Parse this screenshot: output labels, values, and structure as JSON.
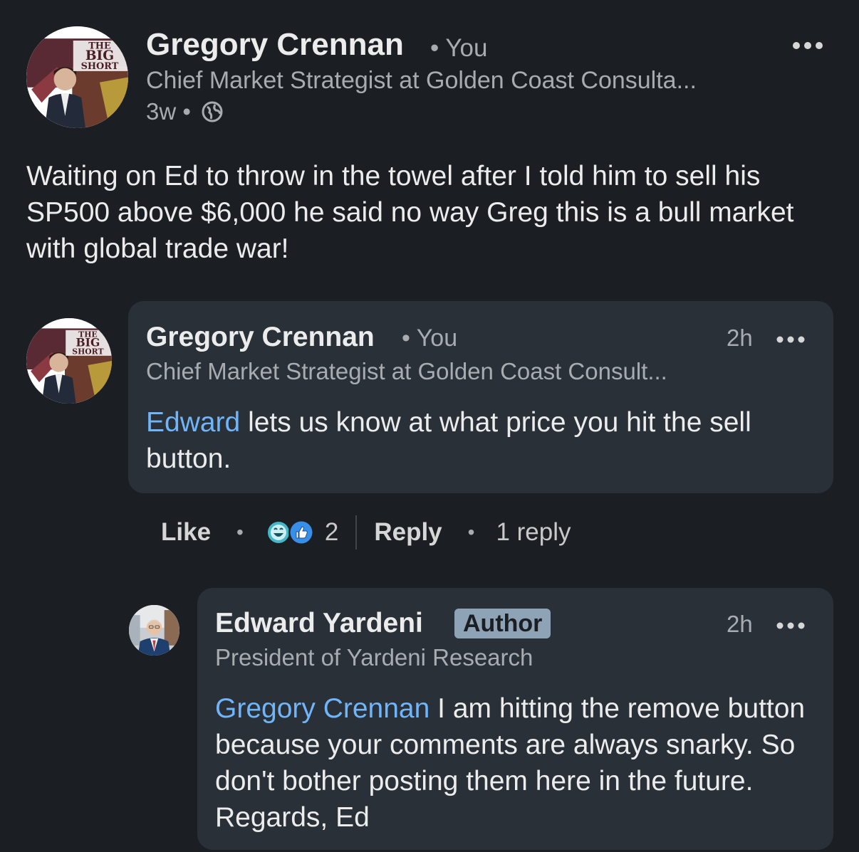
{
  "post": {
    "author": "Gregory Crennan",
    "relation": "• You",
    "headline": "Chief Market Strategist at Golden Coast Consulta...",
    "age": "3w •",
    "visibility_icon": "globe-icon",
    "more_icon": "more-horizontal-icon",
    "avatar_text": {
      "l1": "THE",
      "l2": "BIG",
      "l3": "SHORT"
    },
    "body": "Waiting on Ed to throw in the towel  after I told him to sell his SP500 above $6,000 he said no way Greg this is a bull market with global trade war!"
  },
  "comment": {
    "author": "Gregory Crennan",
    "relation": "• You",
    "headline": "Chief Market Strategist at Golden Coast Consult...",
    "time": "2h",
    "mention": "Edward",
    "text": " lets us know at what price you hit the sell button.",
    "avatar_text": {
      "l1": "THE",
      "l2": "BIG",
      "l3": "SHORT"
    }
  },
  "actions": {
    "like": "Like",
    "sep1": "•",
    "reaction_icons": [
      "laugh-reaction-icon",
      "like-reaction-icon"
    ],
    "reaction_count": "2",
    "reply": "Reply",
    "sep2": "•",
    "replies": "1 reply"
  },
  "reply": {
    "author": "Edward Yardeni",
    "badge": "Author",
    "headline": "President of Yardeni Research",
    "time": "2h",
    "mention": "Gregory Crennan",
    "text": " I am hitting the remove button because your comments are always snarky. So don't bother posting them here in the future. Regards, Ed"
  },
  "colors": {
    "background": "#1b1f23",
    "bubble": "#293038",
    "mention": "#70b5f9",
    "badge": "#8fa3b6"
  }
}
